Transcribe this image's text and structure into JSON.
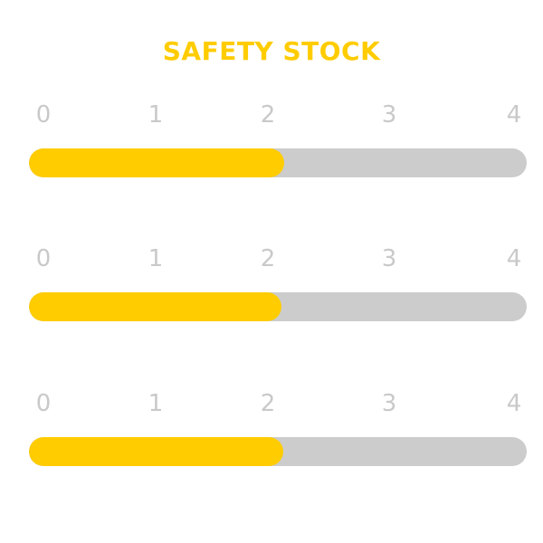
{
  "title": "SAFETY STOCK",
  "colors": {
    "title": "#ffcc00",
    "fill": "#ffcc00",
    "track": "#cccccc",
    "tick_text": "#c9c9c9"
  },
  "scale": {
    "ticks": [
      "0",
      "1",
      "2",
      "3",
      "4"
    ],
    "min": 0,
    "max": 4
  },
  "bars": [
    {
      "value": 2.05
    },
    {
      "value": 2.03
    },
    {
      "value": 2.04
    }
  ]
}
